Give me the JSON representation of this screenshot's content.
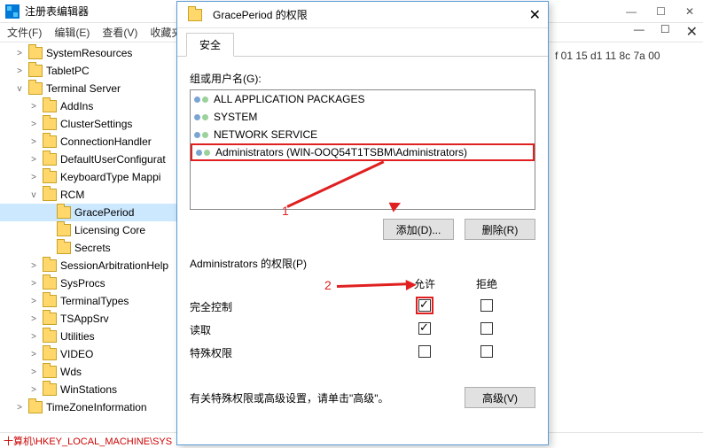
{
  "regedit": {
    "title": "注册表编辑器",
    "menu": {
      "file": "文件(F)",
      "edit": "编辑(E)",
      "view": "查看(V)",
      "favorites": "收藏夹"
    },
    "tree": [
      {
        "indent": 1,
        "exp": ">",
        "label": "SystemResources"
      },
      {
        "indent": 1,
        "exp": ">",
        "label": "TabletPC"
      },
      {
        "indent": 1,
        "exp": "v",
        "label": "Terminal Server"
      },
      {
        "indent": 2,
        "exp": ">",
        "label": "AddIns"
      },
      {
        "indent": 2,
        "exp": ">",
        "label": "ClusterSettings"
      },
      {
        "indent": 2,
        "exp": ">",
        "label": "ConnectionHandler"
      },
      {
        "indent": 2,
        "exp": ">",
        "label": "DefaultUserConfigurat"
      },
      {
        "indent": 2,
        "exp": ">",
        "label": "KeyboardType Mappi"
      },
      {
        "indent": 2,
        "exp": "v",
        "label": "RCM"
      },
      {
        "indent": 3,
        "exp": "",
        "label": "GracePeriod",
        "selected": true
      },
      {
        "indent": 3,
        "exp": "",
        "label": "Licensing Core"
      },
      {
        "indent": 3,
        "exp": "",
        "label": "Secrets"
      },
      {
        "indent": 2,
        "exp": ">",
        "label": "SessionArbitrationHelp"
      },
      {
        "indent": 2,
        "exp": ">",
        "label": "SysProcs"
      },
      {
        "indent": 2,
        "exp": ">",
        "label": "TerminalTypes"
      },
      {
        "indent": 2,
        "exp": ">",
        "label": "TSAppSrv"
      },
      {
        "indent": 2,
        "exp": ">",
        "label": "Utilities"
      },
      {
        "indent": 2,
        "exp": ">",
        "label": "VIDEO"
      },
      {
        "indent": 2,
        "exp": ">",
        "label": "Wds"
      },
      {
        "indent": 2,
        "exp": ">",
        "label": "WinStations"
      },
      {
        "indent": 1,
        "exp": ">",
        "label": "TimeZoneInformation"
      }
    ],
    "statusbar": "十算机\\HKEY_LOCAL_MACHINE\\SYS",
    "hex": "f 01 15 d1 11 8c 7a 00"
  },
  "dialog": {
    "title": "GracePeriod 的权限",
    "tab_security": "安全",
    "groups_label": "组或用户名(G):",
    "users": [
      {
        "name": "ALL APPLICATION PACKAGES"
      },
      {
        "name": "SYSTEM"
      },
      {
        "name": "NETWORK SERVICE"
      },
      {
        "name": "Administrators (WIN-OOQ54T1TSBM\\Administrators)",
        "selected": true
      }
    ],
    "add_btn": "添加(D)...",
    "remove_btn": "删除(R)",
    "perm_label": "Administrators 的权限(P)",
    "col_allow": "允许",
    "col_deny": "拒绝",
    "perms": [
      {
        "name": "完全控制",
        "allow": true,
        "deny": false,
        "highlight": true
      },
      {
        "name": "读取",
        "allow": true,
        "deny": false
      },
      {
        "name": "特殊权限",
        "allow": false,
        "deny": false
      }
    ],
    "special_note": "有关特殊权限或高级设置，请单击\"高级\"。",
    "advanced_btn": "高级(V)"
  },
  "annot": {
    "one": "1",
    "two": "2"
  },
  "winbtns": {
    "min": "—",
    "max": "☐",
    "close": "✕"
  }
}
